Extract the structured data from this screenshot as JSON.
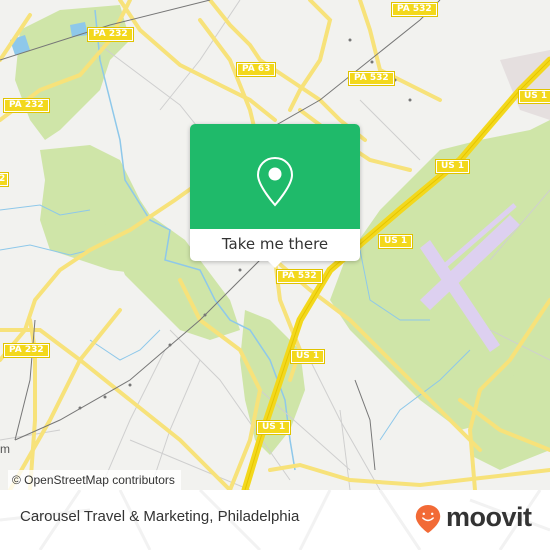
{
  "map": {
    "attribution": "© OpenStreetMap contributors",
    "route_shields": [
      {
        "id": "pa232-top",
        "label": "PA 232"
      },
      {
        "id": "pa232-left",
        "label": "PA 232"
      },
      {
        "id": "pa232-edge",
        "label": "2"
      },
      {
        "id": "pa232-bottom",
        "label": "PA 232"
      },
      {
        "id": "pa63",
        "label": "PA 63"
      },
      {
        "id": "pa532-top",
        "label": "PA 532"
      },
      {
        "id": "pa532-mid",
        "label": "PA 532"
      },
      {
        "id": "pa532-popup",
        "label": "PA 532"
      },
      {
        "id": "us1-topright",
        "label": "US 1"
      },
      {
        "id": "us1-mid",
        "label": "US 1"
      },
      {
        "id": "us1-center",
        "label": "US 1"
      },
      {
        "id": "us1-lower",
        "label": "US 1"
      },
      {
        "id": "us1-bottom",
        "label": "US 1"
      }
    ],
    "partial_label": "m",
    "colors": {
      "land": "#f2f2ef",
      "park": "#cfe5a8",
      "water": "#8ec8ea",
      "road_major": "#f7e27a",
      "road_minor": "#cfcfcf",
      "runway": "#ddd0f0",
      "rail": "#777777"
    }
  },
  "popup": {
    "icon": "location-pin-icon",
    "button_label": "Take me there",
    "color": "#1fba6a"
  },
  "footer": {
    "place_title": "Carousel Travel & Marketing, Philadelphia",
    "brand": "moovit",
    "brand_color": "#f26a36"
  }
}
